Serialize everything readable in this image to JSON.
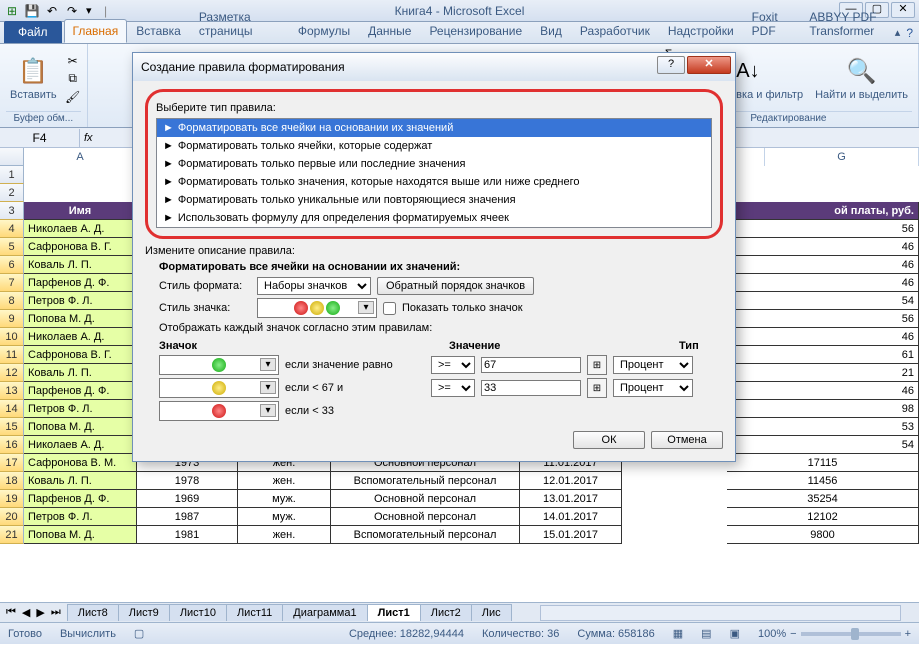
{
  "app_title": "Книга4 - Microsoft Excel",
  "qat_icons": [
    "excel",
    "save",
    "undo",
    "redo"
  ],
  "file_tab": "Файл",
  "ribbon_tabs": [
    "Главная",
    "Вставка",
    "Разметка страницы",
    "Формулы",
    "Данные",
    "Рецензирование",
    "Вид",
    "Разработчик",
    "Надстройки",
    "Foxit PDF",
    "ABBYY PDF Transformer"
  ],
  "ribbon_active_tab": "Главная",
  "paste_label": "Вставить",
  "clipboard_group": "Буфер обм...",
  "sort_label": "Сортировка и фильтр",
  "find_label": "Найти и выделить",
  "editing_group": "Редактирование",
  "namebox_value": "F4",
  "col_headers": [
    "A",
    "G"
  ],
  "table_headers": {
    "name": "Имя",
    "salary": "ой платы, руб."
  },
  "rows": [
    {
      "n": "4",
      "name": "Николаев А. Д.",
      "salary": "56"
    },
    {
      "n": "5",
      "name": "Сафронова В. Г.",
      "salary": "46"
    },
    {
      "n": "6",
      "name": "Коваль Л. П.",
      "salary": "46"
    },
    {
      "n": "7",
      "name": "Парфенов Д. Ф.",
      "salary": "46"
    },
    {
      "n": "8",
      "name": "Петров Ф. Л.",
      "salary": "54"
    },
    {
      "n": "9",
      "name": "Попова М. Д.",
      "salary": "56"
    },
    {
      "n": "10",
      "name": "Николаев А. Д.",
      "salary": "46"
    },
    {
      "n": "11",
      "name": "Сафронова В. Г.",
      "salary": "61"
    },
    {
      "n": "12",
      "name": "Коваль Л. П.",
      "salary": "21"
    },
    {
      "n": "13",
      "name": "Парфенов Д. Ф.",
      "salary": "46"
    },
    {
      "n": "14",
      "name": "Петров Ф. Л.",
      "salary": "98"
    },
    {
      "n": "15",
      "name": "Попова М. Д.",
      "salary": "53"
    },
    {
      "n": "16",
      "name": "Николаев А. Д.",
      "salary": "54"
    }
  ],
  "visible_rows": [
    {
      "n": "17",
      "name": "Сафронова В. М.",
      "year": "1973",
      "sex": "жен.",
      "cat": "Основной персонал",
      "date": "11.01.2017",
      "salary": "17115"
    },
    {
      "n": "18",
      "name": "Коваль Л. П.",
      "year": "1978",
      "sex": "жен.",
      "cat": "Вспомогательный персонал",
      "date": "12.01.2017",
      "salary": "11456"
    },
    {
      "n": "19",
      "name": "Парфенов Д. Ф.",
      "year": "1969",
      "sex": "муж.",
      "cat": "Основной персонал",
      "date": "13.01.2017",
      "salary": "35254"
    },
    {
      "n": "20",
      "name": "Петров Ф. Л.",
      "year": "1987",
      "sex": "муж.",
      "cat": "Основной персонал",
      "date": "14.01.2017",
      "salary": "12102"
    },
    {
      "n": "21",
      "name": "Попова М. Д.",
      "year": "1981",
      "sex": "жен.",
      "cat": "Вспомогательный персонал",
      "date": "15.01.2017",
      "salary": "9800"
    }
  ],
  "sheet_tabs": [
    "Лист8",
    "Лист9",
    "Лист10",
    "Лист11",
    "Диаграмма1",
    "Лист1",
    "Лист2",
    "Лис"
  ],
  "active_sheet": "Лист1",
  "status": {
    "ready": "Готово",
    "calc": "Вычислить",
    "avg": "Среднее: 18282,94444",
    "count": "Количество: 36",
    "sum": "Сумма: 658186",
    "zoom": "100%"
  },
  "dialog": {
    "title": "Создание правила форматирования",
    "choose_label": "Выберите тип правила:",
    "rules": [
      "Форматировать все ячейки на основании их значений",
      "Форматировать только ячейки, которые содержат",
      "Форматировать только первые или последние значения",
      "Форматировать только значения, которые находятся выше или ниже среднего",
      "Форматировать только уникальные или повторяющиеся значения",
      "Использовать формулу для определения форматируемых ячеек"
    ],
    "edit_label": "Измените описание правила:",
    "format_header": "Форматировать все ячейки на основании их значений:",
    "style_label": "Стиль формата:",
    "style_value": "Наборы значков",
    "reverse_btn": "Обратный порядок значков",
    "icon_style_label": "Стиль значка:",
    "show_only_label": "Показать только значок",
    "display_rules_label": "Отображать каждый значок согласно этим правилам:",
    "col_icon": "Значок",
    "col_value": "Значение",
    "col_type": "Тип",
    "cond1": "если значение равно",
    "cond2": "если < 67 и",
    "cond3": "если < 33",
    "op": ">=",
    "val1": "67",
    "val2": "33",
    "type_val": "Процент",
    "ok": "ОК",
    "cancel": "Отмена"
  }
}
